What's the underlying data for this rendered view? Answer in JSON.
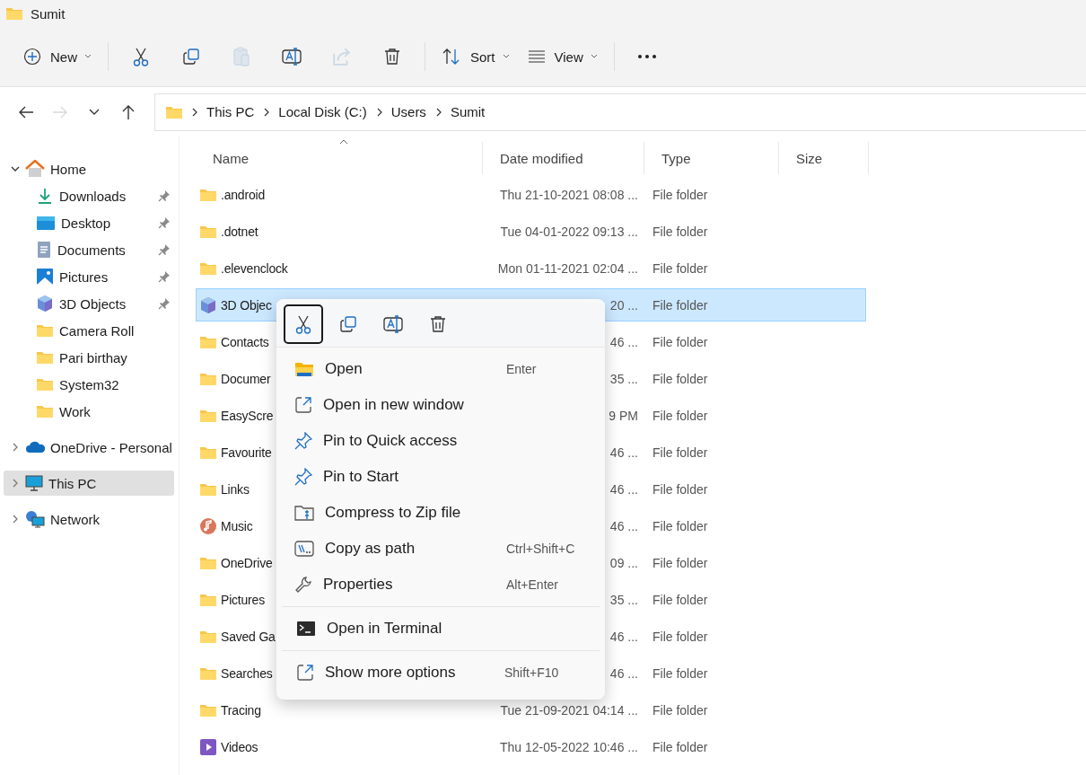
{
  "window": {
    "title": "Sumit"
  },
  "toolbar": [
    {
      "kind": "new",
      "label": "New",
      "disabled": false
    },
    {
      "kind": "cut",
      "disabled": false
    },
    {
      "kind": "copy",
      "disabled": false
    },
    {
      "kind": "paste",
      "disabled": true
    },
    {
      "kind": "rename",
      "disabled": false
    },
    {
      "kind": "share",
      "disabled": true
    },
    {
      "kind": "delete",
      "disabled": false
    },
    {
      "kind": "sort",
      "label": "Sort",
      "disabled": false
    },
    {
      "kind": "view",
      "label": "View",
      "disabled": false
    },
    {
      "kind": "more",
      "disabled": false
    }
  ],
  "navigation": [
    {
      "kind": "back",
      "disabled": false
    },
    {
      "kind": "forward",
      "disabled": true
    },
    {
      "kind": "recent",
      "disabled": false
    },
    {
      "kind": "up",
      "disabled": false
    }
  ],
  "address_bar": {
    "path": [
      "This PC",
      "Local Disk (C:)",
      "Users",
      "Sumit"
    ]
  },
  "sidebar": {
    "items": [
      {
        "label": "Home",
        "kind": "home",
        "expanded": true,
        "selected": false,
        "children": [
          {
            "label": "Downloads",
            "kind": "download",
            "pinned": true,
            "selected": false
          },
          {
            "label": "Desktop",
            "kind": "desktop",
            "pinned": true,
            "selected": false
          },
          {
            "label": "Documents",
            "kind": "document",
            "pinned": true,
            "selected": false
          },
          {
            "label": "Pictures",
            "kind": "pictures",
            "pinned": true,
            "selected": false
          },
          {
            "label": "3D Objects",
            "kind": "cube",
            "pinned": true,
            "selected": false
          },
          {
            "label": "Camera Roll",
            "kind": "folder",
            "pinned": false,
            "selected": false
          },
          {
            "label": "Pari birthay",
            "kind": "folder",
            "pinned": false,
            "selected": false
          },
          {
            "label": "System32",
            "kind": "folder",
            "pinned": false,
            "selected": false
          },
          {
            "label": "Work",
            "kind": "folder",
            "pinned": false,
            "selected": false
          }
        ]
      },
      {
        "label": "OneDrive - Personal",
        "kind": "cloud",
        "expanded": false,
        "selected": false
      },
      {
        "label": "This PC",
        "kind": "pc",
        "expanded": false,
        "selected": true
      },
      {
        "label": "Network",
        "kind": "network",
        "expanded": false,
        "selected": false
      }
    ]
  },
  "table": {
    "columns": [
      {
        "label": "Name",
        "sorted": true
      },
      {
        "label": "Date modified",
        "sorted": false
      },
      {
        "label": "Type",
        "sorted": false
      },
      {
        "label": "Size",
        "sorted": false
      }
    ],
    "rows": [
      {
        "kind": "folder",
        "name": ".android",
        "date": "Thu 21-10-2021 08:08 ...",
        "type": "File folder",
        "selected": false
      },
      {
        "kind": "folder",
        "name": ".dotnet",
        "date": "Tue 04-01-2022 09:13 ...",
        "type": "File folder",
        "selected": false
      },
      {
        "kind": "folder",
        "name": ".elevenclock",
        "date": "Mon 01-11-2021 02:04 ...",
        "type": "File folder",
        "selected": false
      },
      {
        "kind": "cube",
        "name": "3D Objec",
        "date": "20 ...",
        "type": "File folder",
        "selected": true
      },
      {
        "kind": "folder",
        "name": "Contacts",
        "date": "46 ...",
        "type": "File folder",
        "selected": false
      },
      {
        "kind": "folder",
        "name": "Documer",
        "date": "35 ...",
        "type": "File folder",
        "selected": false
      },
      {
        "kind": "folder",
        "name": "EasyScre",
        "date": "9 PM",
        "type": "File folder",
        "selected": false
      },
      {
        "kind": "folder",
        "name": "Favourite",
        "date": "46 ...",
        "type": "File folder",
        "selected": false
      },
      {
        "kind": "folder",
        "name": "Links",
        "date": "46 ...",
        "type": "File folder",
        "selected": false
      },
      {
        "kind": "music",
        "name": "Music",
        "date": "46 ...",
        "type": "File folder",
        "selected": false
      },
      {
        "kind": "folder",
        "name": "OneDrive",
        "date": "09 ...",
        "type": "File folder",
        "selected": false
      },
      {
        "kind": "folder",
        "name": "Pictures",
        "date": "35 ...",
        "type": "File folder",
        "selected": false
      },
      {
        "kind": "folder",
        "name": "Saved Ga",
        "date": "46 ...",
        "type": "File folder",
        "selected": false
      },
      {
        "kind": "folder",
        "name": "Searches",
        "date": "46 ...",
        "type": "File folder",
        "selected": false
      },
      {
        "kind": "folder",
        "name": "Tracing",
        "date": "Tue 21-09-2021 04:14 ...",
        "type": "File folder",
        "selected": false
      },
      {
        "kind": "videos",
        "name": "Videos",
        "date": "Thu 12-05-2022 10:46 ...",
        "type": "File folder",
        "selected": false
      }
    ]
  },
  "context_menu": {
    "quick_actions": [
      {
        "kind": "cut",
        "focused": true
      },
      {
        "kind": "copy",
        "focused": false
      },
      {
        "kind": "rename",
        "focused": false
      },
      {
        "kind": "delete",
        "focused": false
      }
    ],
    "groups": [
      [
        {
          "kind": "open",
          "label": "Open",
          "shortcut": "Enter"
        },
        {
          "kind": "new-window",
          "label": "Open in new window"
        },
        {
          "kind": "pin",
          "label": "Pin to Quick access"
        },
        {
          "kind": "pin",
          "label": "Pin to Start"
        },
        {
          "kind": "zip",
          "label": "Compress to Zip file"
        },
        {
          "kind": "path",
          "label": "Copy as path",
          "shortcut": "Ctrl+Shift+C"
        },
        {
          "kind": "wrench",
          "label": "Properties",
          "shortcut": "Alt+Enter"
        }
      ],
      [
        {
          "kind": "terminal",
          "label": "Open in Terminal"
        }
      ],
      [
        {
          "kind": "more-options",
          "label": "Show more options",
          "shortcut": "Shift+F10"
        }
      ]
    ]
  }
}
